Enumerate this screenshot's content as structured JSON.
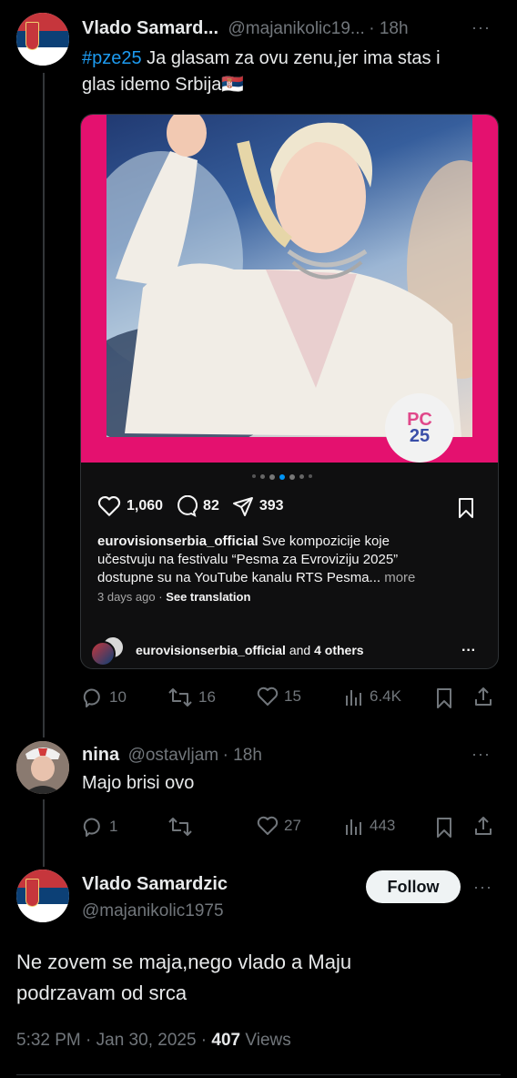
{
  "tweet1": {
    "name": "Vlado Samard...",
    "handle": "@majanikolic19...",
    "time": "· 18h",
    "more": "···",
    "hashtag": "#pze25",
    "text_line1": " Ja glasam za ovu zenu,jer ima stas i",
    "text_line2": "glas idemo Srbija",
    "flag_emoji": "🇷🇸",
    "embed": {
      "logo_text_top": "PC",
      "logo_text_bottom": "25",
      "likes": "1,060",
      "comments": "82",
      "shares": "393",
      "account": "eurovisionserbia_official",
      "caption_line1": " Sve kompozicije koje",
      "caption_line2": "učestvuju na festivalu “Pesma za Evroviziju 2025”",
      "caption_line3": "dostupne su na YouTube kanalu RTS Pesma...",
      "caption_more": " more",
      "date": "3 days ago",
      "see_translation": "See translation",
      "footer_account": "eurovisionserbia_official",
      "footer_and": " and ",
      "footer_others": "4 others",
      "footer_more": "···"
    },
    "stats": {
      "replies": "10",
      "reposts": "16",
      "likes": "15",
      "views": "6.4K"
    }
  },
  "tweet2": {
    "name": "nina",
    "handle": "@ostavljam",
    "time": "· 18h",
    "more": "···",
    "text": "Majo brisi ovo",
    "stats": {
      "replies": "1",
      "reposts": "",
      "likes": "27",
      "views": "443"
    }
  },
  "tweet3": {
    "name": "Vlado Samardzic",
    "handle": "@majanikolic1975",
    "follow": "Follow",
    "more": "···",
    "text_line1": "Ne zovem se maja,nego vlado a Maju",
    "text_line2": "podrzavam od srca",
    "timestamp": "5:32 PM · Jan 30, 2025 · ",
    "views_count": "407",
    "views_label": " Views"
  },
  "colors": {
    "accent": "#1d9bf0",
    "magenta": "#e4116f",
    "muted": "#71767b"
  }
}
